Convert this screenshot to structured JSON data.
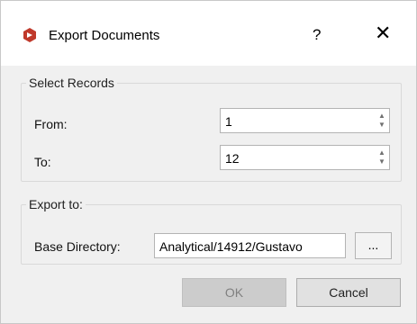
{
  "window": {
    "title": "Export Documents",
    "help_label": "?",
    "close_label": "✕",
    "accent": "#c0392b"
  },
  "records": {
    "group_label": "Select Records",
    "from_label": "From:",
    "from_value": "1",
    "to_label": "To:",
    "to_value": "12"
  },
  "export": {
    "group_label": "Export to:",
    "base_dir_label": "Base Directory:",
    "base_dir_value": "Analytical/14912/Gustavo",
    "browse_label": "..."
  },
  "buttons": {
    "ok_label": "OK",
    "cancel_label": "Cancel"
  }
}
